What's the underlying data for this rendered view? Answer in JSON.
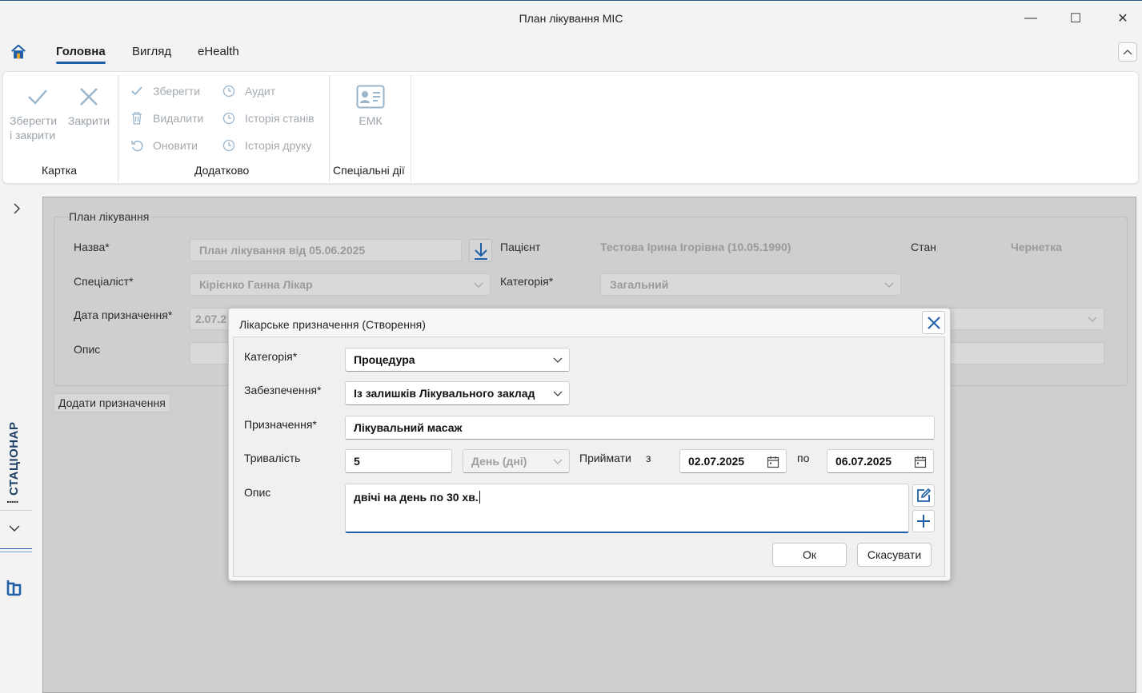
{
  "window": {
    "title": "План лікування МІС",
    "minimize_glyph": "—",
    "maximize_glyph": "☐",
    "close_glyph": "✕"
  },
  "tabs": {
    "items": [
      {
        "label": "Головна",
        "active": true
      },
      {
        "label": "Вигляд",
        "active": false
      },
      {
        "label": "eHealth",
        "active": false
      }
    ],
    "collapse_glyph": "︿"
  },
  "ribbon": {
    "groups": {
      "card": {
        "label": "Картка",
        "save_close": "Зберегти\nі закрити",
        "close": "Закрити"
      },
      "extra": {
        "label": "Додатково",
        "save": "Зберегти",
        "delete": "Видалити",
        "refresh": "Оновити",
        "audit": "Аудит",
        "state_history": "Історія станів",
        "print_history": "Історія друку"
      },
      "special": {
        "label": "Спеціальні дії",
        "emk": "ЕМК"
      }
    }
  },
  "side": {
    "vertical_label": "СТАЦІОНАР",
    "dots": ".....",
    "expand_glyph": "›",
    "down_glyph": "⌵"
  },
  "plan": {
    "group_title": "План лікування",
    "name_label": "Назва*",
    "name_value": "План лікування від 05.06.2025",
    "patient_label": "Пацієнт",
    "patient_value": "Тестова Ірина Ігорівна (10.05.1990)",
    "state_label": "Стан",
    "state_value": "Чернетка",
    "specialist_label": "Спеціаліст*",
    "specialist_value": "Кірієнко Ганна Лікар",
    "category_label": "Категорія*",
    "category_value": "Загальний",
    "date_label": "Дата призначення*",
    "date_value": "2.07.2",
    "desc_label": "Опис",
    "add_button": "Додати призначення"
  },
  "dialog": {
    "title": "Лікарське призначення (Створення)",
    "category_label": "Категорія*",
    "category_value": "Процедура",
    "supply_label": "Забезпечення*",
    "supply_value": "Із залишків Лікувального заклад",
    "purpose_label": "Призначення*",
    "purpose_value": "Лікувальний масаж",
    "duration_label": "Тривалість",
    "duration_value": "5",
    "duration_unit": "День (дні)",
    "take_label": "Приймати",
    "from_label": "з",
    "from_date": "02.07.2025",
    "to_label": "по",
    "to_date": "06.07.2025",
    "desc_label": "Опис",
    "desc_value": "двічі на день по 30 хв.",
    "ok_button": "Ок",
    "cancel_button": "Скасувати"
  },
  "colors": {
    "accent": "#1f5fa8",
    "disabled_icon": "#9ab6cc",
    "overlay": "#cfcfcf"
  }
}
